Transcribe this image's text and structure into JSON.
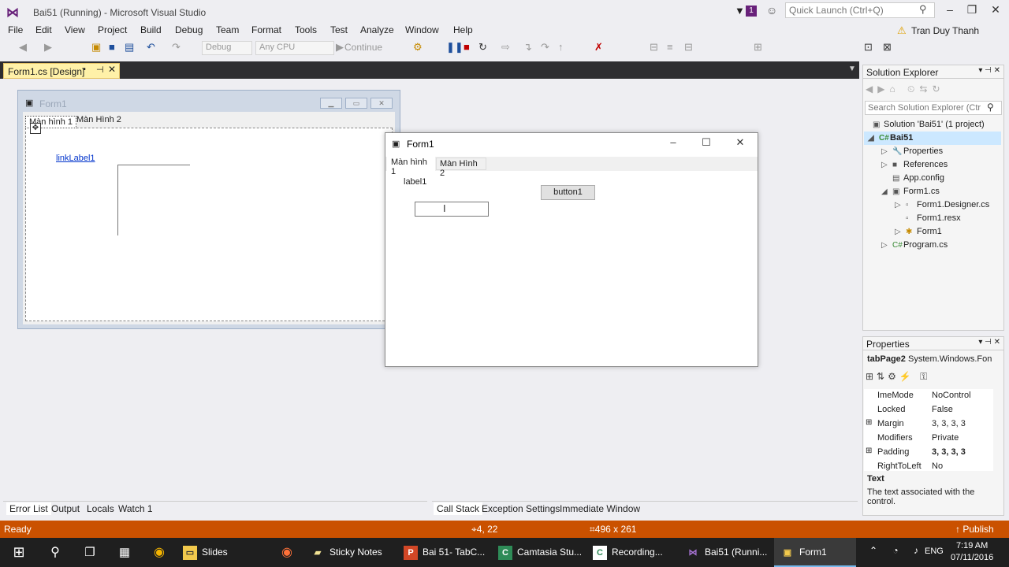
{
  "window": {
    "title": "Bai51 (Running) - Microsoft Visual Studio",
    "notification_count": "1",
    "quick_launch_placeholder": "Quick Launch (Ctrl+Q)",
    "user": "Tran Duy Thanh"
  },
  "menu": [
    "File",
    "Edit",
    "View",
    "Project",
    "Build",
    "Debug",
    "Team",
    "Format",
    "Tools",
    "Test",
    "Analyze",
    "Window",
    "Help"
  ],
  "toolbar": {
    "config": "Debug",
    "platform": "Any CPU",
    "continue": "Continue"
  },
  "document_tab": {
    "label": "Form1.cs [Design]"
  },
  "design_form": {
    "title": "Form1",
    "tabs": [
      "Màn hình 1",
      "Màn Hình 2"
    ],
    "link_label": "linkLabel1"
  },
  "running_form": {
    "title": "Form1",
    "tabs": [
      "Màn hình 1",
      "Màn Hình 2"
    ],
    "label": "label1",
    "button": "button1",
    "textbox_value": ""
  },
  "solution_explorer": {
    "title": "Solution Explorer",
    "search_placeholder": "Search Solution Explorer (Ctr",
    "items": [
      {
        "label": "Solution 'Bai51' (1 project)",
        "icon": "solution-icon"
      },
      {
        "label": "Bai51",
        "icon": "csharp-project-icon",
        "bold": true
      },
      {
        "label": "Properties",
        "icon": "wrench-icon"
      },
      {
        "label": "References",
        "icon": "references-icon"
      },
      {
        "label": "App.config",
        "icon": "config-icon"
      },
      {
        "label": "Form1.cs",
        "icon": "form-icon"
      },
      {
        "label": "Form1.Designer.cs",
        "icon": "cs-file-icon"
      },
      {
        "label": "Form1.resx",
        "icon": "resx-icon"
      },
      {
        "label": "Form1",
        "icon": "class-icon"
      },
      {
        "label": "Program.cs",
        "icon": "cs-file-icon"
      }
    ]
  },
  "properties": {
    "title": "Properties",
    "object_name": "tabPage2",
    "object_type": "System.Windows.Fon",
    "rows": [
      {
        "name": "ImeMode",
        "value": "NoControl"
      },
      {
        "name": "Locked",
        "value": "False"
      },
      {
        "name": "Margin",
        "value": "3, 3, 3, 3",
        "expandable": true
      },
      {
        "name": "Modifiers",
        "value": "Private"
      },
      {
        "name": "Padding",
        "value": "3, 3, 3, 3",
        "expandable": true,
        "bold_value": true
      },
      {
        "name": "RightToLeft",
        "value": "No"
      }
    ],
    "description_title": "Text",
    "description_text": "The text associated with the control."
  },
  "bottom_tabs_left": [
    "Error List",
    "Output",
    "Locals",
    "Watch 1"
  ],
  "bottom_tabs_right": [
    "Call Stack",
    "Exception Settings",
    "Immediate Window"
  ],
  "status": {
    "text": "Ready",
    "position": "4, 22",
    "size": "496 x 261",
    "publish": "Publish"
  },
  "taskbar": {
    "items": [
      "Slides",
      "Sticky Notes",
      "Bai 51- TabC...",
      "Camtasia Stu...",
      "Recording...",
      "Bai51 (Runni...",
      "Form1"
    ],
    "lang": "ENG",
    "time": "7:19 AM",
    "date": "07/11/2016"
  },
  "colors": {
    "status_bar": "#ca5100",
    "vs_purple": "#68217a",
    "doc_tab": "#fff1a8",
    "taskbar": "#1f1f1f"
  }
}
